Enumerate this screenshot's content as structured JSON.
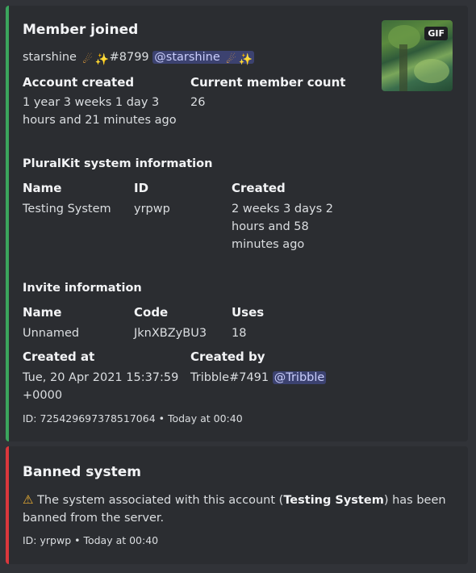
{
  "embed1": {
    "title": "Member joined",
    "user": {
      "name": "starshine",
      "tag": "#8799",
      "mention": "@starshine"
    },
    "account_created": {
      "label": "Account created",
      "value": "1 year 3 weeks 1 day 3 hours and 21 minutes ago"
    },
    "member_count": {
      "label": "Current member count",
      "value": "26"
    },
    "pluralkit": {
      "section": "PluralKit system information",
      "name": {
        "label": "Name",
        "value": "Testing System"
      },
      "id": {
        "label": "ID",
        "value": "yrpwp"
      },
      "created": {
        "label": "Created",
        "value": "2 weeks 3 days 2 hours and 58 minutes ago"
      }
    },
    "invite": {
      "section": "Invite information",
      "name": {
        "label": "Name",
        "value": "Unnamed"
      },
      "code": {
        "label": "Code",
        "value": "JknXBZyBU3"
      },
      "uses": {
        "label": "Uses",
        "value": "18"
      },
      "created_at": {
        "label": "Created at",
        "value": "Tue, 20 Apr 2021 15:37:59 +0000"
      },
      "created_by": {
        "label": "Created by",
        "value": "Tribble#7491",
        "mention": "@Tribble"
      }
    },
    "footer": "ID: 725429697378517064 • Today at 00:40",
    "thumbnail": {
      "badge": "GIF"
    },
    "accent_color": "#3ba55d"
  },
  "embed2": {
    "title": "Banned system",
    "description": {
      "before": "The system associated with this account (",
      "bold": "Testing System",
      "after": ") has been banned from the server."
    },
    "footer": "ID: yrpwp • Today at 00:40",
    "accent_color": "#da373c"
  },
  "icons": {
    "emoji": [
      "comet-emoji",
      "sparkles-emoji"
    ],
    "warning": "warning-icon"
  }
}
